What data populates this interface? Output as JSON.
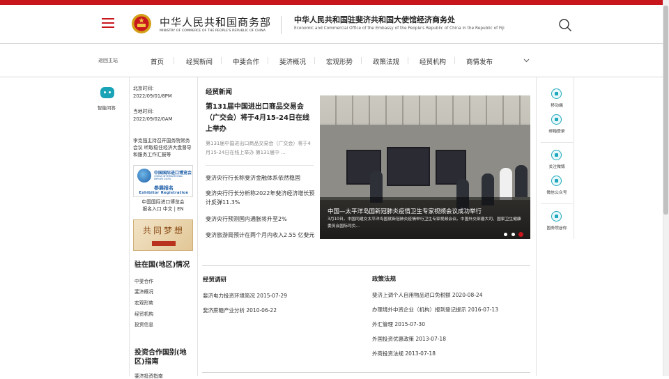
{
  "header": {
    "ministry_cn": "中华人民共和国商务部",
    "ministry_en": "MINISTRY OF COMMERCE OF THE PEOPLE'S REPUBLIC OF CHINA",
    "office_cn": "中华人民共和国驻斐济共和国大使馆经济商务处",
    "office_en": "Economic and Commercial Office of the Embassy of the People's Republic of China in the Republic of Fiji"
  },
  "nav": {
    "back_home": "返回主站",
    "items": [
      "首页",
      "经贸新闻",
      "中斐合作",
      "斐济概况",
      "宏观形势",
      "政策法规",
      "经贸机构",
      "商情发布"
    ]
  },
  "left": {
    "assistant_label": "智能问答",
    "beijing_time_label": "北京时间:",
    "beijing_time": "2022/09/01/8PM",
    "local_time_label": "当地时间:",
    "local_time": "2022/09/02/0AM",
    "headline": "李克强主持召开国务院常务会议 听取稳住经济大盘督导和服务工作汇报等",
    "expo_cn": "中国国际进口博览会",
    "expo_en": "CHINA INTERNATIONAL IMPORT EXPO",
    "expo_reg_cn": "参展报名",
    "expo_reg_en": "Exhibitor Registration",
    "expo_caption_1": "中国国际进口博览会",
    "expo_caption_2": "报名入口 中文 | EN",
    "dream_text": "共同梦想",
    "region_title": "驻在国(地区)情况",
    "region_links": [
      "中斐合作",
      "斐济概况",
      "宏观形势",
      "经贸机构",
      "投资信息"
    ],
    "guide_title": "投资合作国别(地区)指南",
    "guide_partial": "斐济投资指南"
  },
  "news": {
    "heading": "经贸新闻",
    "featured_title": "第131届中国进出口商品交易会（广交会）将于4月15-24日在线上举办",
    "featured_desc": "第131届中国进出口商品交易会（广交会）将于4月15-24日在线上举办 第131届中 ...",
    "items": [
      "斐济央行行长称斐济金融体系依然稳固",
      "斐济央行行长分析称2022年斐济经济增长预计反弹11.3%",
      "斐济央行预测国内通胀将升至2%",
      "斐济旅游局预计在两个月内收入2.55 亿斐元"
    ]
  },
  "slider": {
    "title": "中国—太平洋岛国新冠肺炎疫情卫生专家视频会议成功举行",
    "desc": "3月10日，中国同建交太平洋岛国就新冠肺炎疫情举行卫生专家视频会议。中国外交部唐大司、国家卫生健康委员会国际司负...",
    "slide_count": 3,
    "active_index": 3
  },
  "right_sidebar": {
    "items": [
      {
        "label": "移动端",
        "icon": "mobile-icon"
      },
      {
        "label": "邮箱登录",
        "icon": "mail-icon"
      },
      {
        "label": "关注微博",
        "icon": "weibo-icon"
      },
      {
        "label": "微信公众号",
        "icon": "wechat-icon"
      },
      {
        "label": "国务院@你",
        "icon": "at-icon"
      }
    ]
  },
  "trade_research": {
    "heading": "经贸调研",
    "items": [
      {
        "title": "斐济电力投资环境简况",
        "date": "2015-07-29"
      },
      {
        "title": "斐济蔗糖产业分析",
        "date": "2010-06-22"
      }
    ]
  },
  "policies": {
    "heading": "政策法规",
    "items": [
      {
        "title": "斐济上调个人自用物品进口免税额",
        "date": "2020-08-24"
      },
      {
        "title": "办理境外中资企业（机构）报到登记提示",
        "date": "2016-07-13"
      },
      {
        "title": "外汇管理",
        "date": "2015-07-30"
      },
      {
        "title": "外国投资优惠政策",
        "date": "2013-07-18"
      },
      {
        "title": "外商投资法规",
        "date": "2013-07-18"
      }
    ]
  }
}
